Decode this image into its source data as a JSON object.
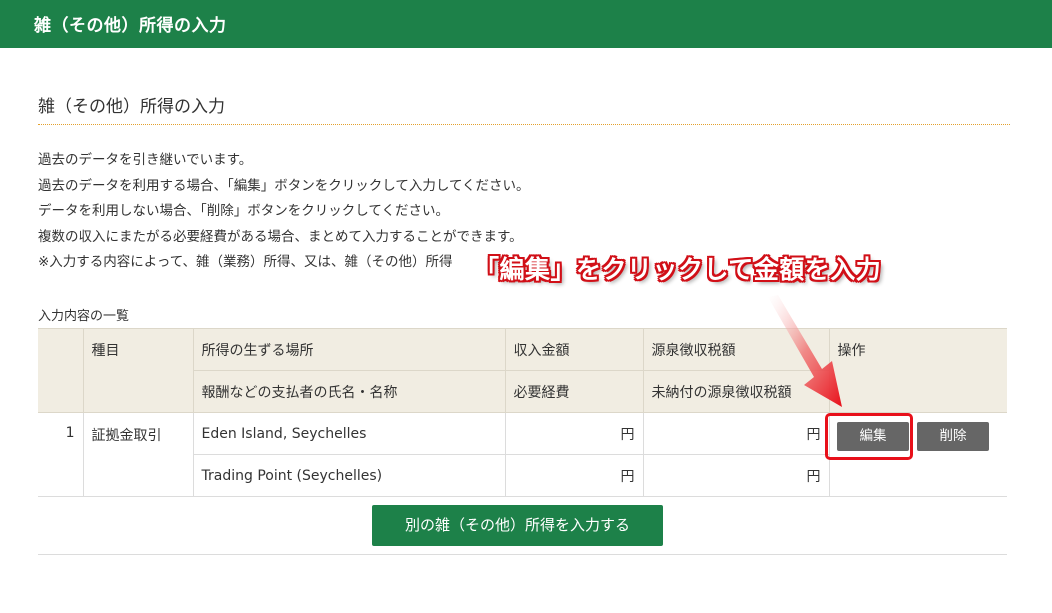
{
  "header": {
    "title": "雑（その他）所得の入力"
  },
  "section": {
    "title": "雑（その他）所得の入力"
  },
  "intro": {
    "lines": [
      "過去のデータを引き継いでいます。",
      "過去のデータを利用する場合、「編集」ボタンをクリックして入力してください。",
      "データを利用しない場合、「削除」ボタンをクリックしてください。",
      "複数の収入にまたがる必要経費がある場合、まとめて入力することができます。",
      "※入力する内容によって、雑（業務）所得、又は、雑（その他）所得"
    ]
  },
  "list": {
    "caption": "入力内容の一覧",
    "headers": {
      "category": "種目",
      "place": "所得の生ずる場所",
      "payer": "報酬などの支払者の氏名・名称",
      "income": "収入金額",
      "expenses": "必要経費",
      "withholding": "源泉徴収税額",
      "unpaid_withholding": "未納付の源泉徴収税額",
      "actions": "操作"
    },
    "rows": [
      {
        "number": "1",
        "category": "証拠金取引",
        "place": "Eden Island, Seychelles",
        "payer": "Trading Point (Seychelles)",
        "income": "円",
        "expenses": "円",
        "withholding": "円",
        "unpaid_withholding": "円",
        "edit_label": "編集",
        "delete_label": "削除"
      }
    ]
  },
  "add_button": {
    "label": "別の雑（その他）所得を入力する"
  },
  "annotation": {
    "callout": "「編集」をクリックして金額を入力",
    "color": "#e8101a"
  },
  "colors": {
    "brand_green": "#1d8149",
    "header_bg": "#f1ede2",
    "button_gray": "#666666"
  }
}
